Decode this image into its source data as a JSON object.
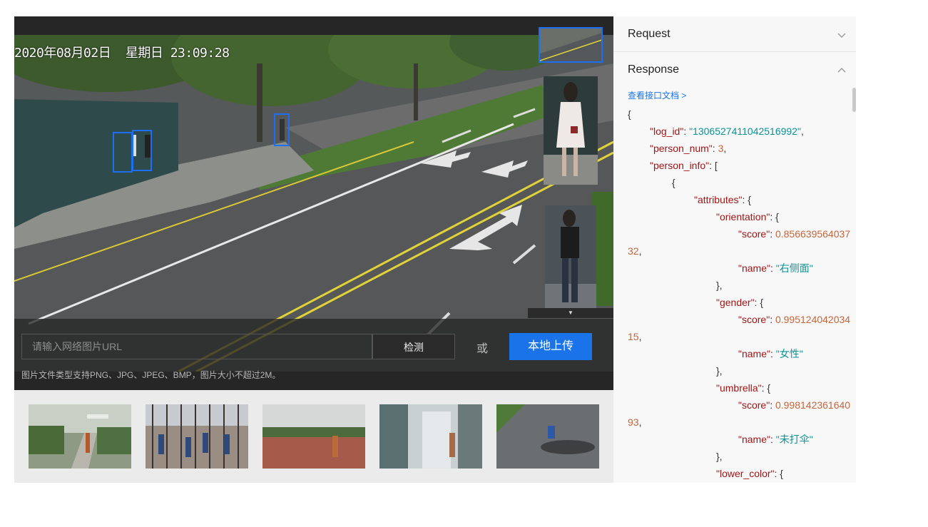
{
  "viewer": {
    "osd_timestamp": "2020年08月02日  星期日 23:09:28"
  },
  "upload": {
    "url_placeholder": "请输入网络图片URL",
    "detect_label": "检测",
    "or_label": "或",
    "upload_label": "本地上传",
    "hint": "图片文件类型支持PNG、JPG、JPEG、BMP，图片大小不超过2M。"
  },
  "samples": [
    "sample-image-1",
    "sample-image-2",
    "sample-image-3",
    "sample-image-4",
    "sample-image-5"
  ],
  "api": {
    "request_label": "Request",
    "response_label": "Response",
    "doc_link": "查看接口文档 >",
    "json_lines": [
      {
        "indent": 0,
        "parts": [
          [
            "p",
            "{"
          ]
        ]
      },
      {
        "indent": 1,
        "parts": [
          [
            "k",
            "\"log_id\""
          ],
          [
            "p",
            ": "
          ],
          [
            "s",
            "\"1306527411042516992\""
          ],
          [
            "p",
            ","
          ]
        ]
      },
      {
        "indent": 1,
        "parts": [
          [
            "k",
            "\"person_num\""
          ],
          [
            "p",
            ": "
          ],
          [
            "n",
            "3"
          ],
          [
            "p",
            ","
          ]
        ]
      },
      {
        "indent": 1,
        "parts": [
          [
            "k",
            "\"person_info\""
          ],
          [
            "p",
            ": ["
          ]
        ]
      },
      {
        "indent": 2,
        "parts": [
          [
            "p",
            "{"
          ]
        ]
      },
      {
        "indent": 3,
        "parts": [
          [
            "k",
            "\"attributes\""
          ],
          [
            "p",
            ": {"
          ]
        ]
      },
      {
        "indent": 4,
        "parts": [
          [
            "k",
            "\"orientation\""
          ],
          [
            "p",
            ": {"
          ]
        ]
      },
      {
        "indent": 5,
        "parts": [
          [
            "k",
            "\"score\""
          ],
          [
            "p",
            ": "
          ],
          [
            "n",
            "0.856639564037"
          ]
        ]
      },
      {
        "indent": 0,
        "parts": [
          [
            "n",
            "32"
          ],
          [
            "p",
            ","
          ]
        ]
      },
      {
        "indent": 5,
        "parts": [
          [
            "k",
            "\"name\""
          ],
          [
            "p",
            ": "
          ],
          [
            "s",
            "\"右侧面\""
          ]
        ]
      },
      {
        "indent": 4,
        "parts": [
          [
            "p",
            "},"
          ]
        ]
      },
      {
        "indent": 4,
        "parts": [
          [
            "k",
            "\"gender\""
          ],
          [
            "p",
            ": {"
          ]
        ]
      },
      {
        "indent": 5,
        "parts": [
          [
            "k",
            "\"score\""
          ],
          [
            "p",
            ": "
          ],
          [
            "n",
            "0.995124042034"
          ]
        ]
      },
      {
        "indent": 0,
        "parts": [
          [
            "n",
            "15"
          ],
          [
            "p",
            ","
          ]
        ]
      },
      {
        "indent": 5,
        "parts": [
          [
            "k",
            "\"name\""
          ],
          [
            "p",
            ": "
          ],
          [
            "s",
            "\"女性\""
          ]
        ]
      },
      {
        "indent": 4,
        "parts": [
          [
            "p",
            "},"
          ]
        ]
      },
      {
        "indent": 4,
        "parts": [
          [
            "k",
            "\"umbrella\""
          ],
          [
            "p",
            ": {"
          ]
        ]
      },
      {
        "indent": 5,
        "parts": [
          [
            "k",
            "\"score\""
          ],
          [
            "p",
            ": "
          ],
          [
            "n",
            "0.998142361640"
          ]
        ]
      },
      {
        "indent": 0,
        "parts": [
          [
            "n",
            "93"
          ],
          [
            "p",
            ","
          ]
        ]
      },
      {
        "indent": 5,
        "parts": [
          [
            "k",
            "\"name\""
          ],
          [
            "p",
            ": "
          ],
          [
            "s",
            "\"未打伞\""
          ]
        ]
      },
      {
        "indent": 4,
        "parts": [
          [
            "p",
            "},"
          ]
        ]
      },
      {
        "indent": 4,
        "parts": [
          [
            "k",
            "\"lower_color\""
          ],
          [
            "p",
            ": {"
          ]
        ]
      }
    ]
  },
  "colors": {
    "accent": "#1a73e8",
    "bbox": "#1c6ef2",
    "json_key": "#a31515",
    "json_string": "#0a9396",
    "json_number": "#c5653a"
  },
  "icons": {
    "collapsed": "chevron-down-icon",
    "expanded": "chevron-up-icon"
  }
}
